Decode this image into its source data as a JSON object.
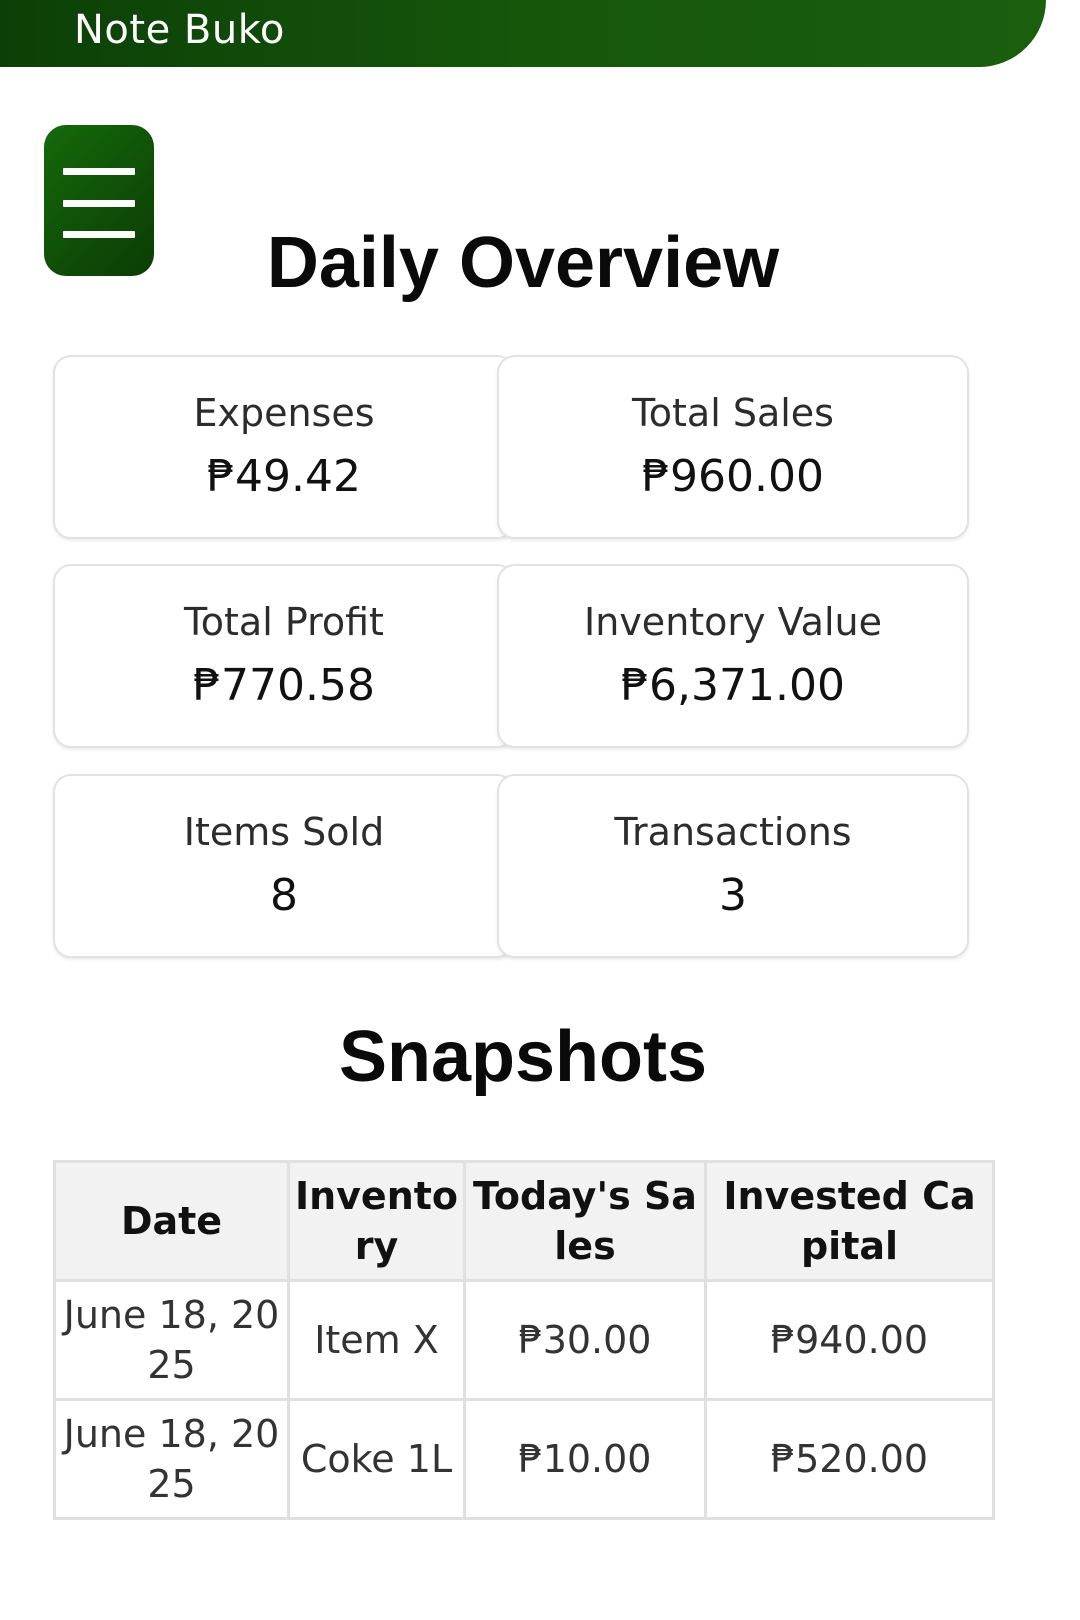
{
  "app": {
    "title": "Note Buko"
  },
  "menu": {
    "icon": "hamburger-menu-icon"
  },
  "overview": {
    "title": "Daily Overview",
    "cards": [
      {
        "label": "Expenses",
        "value": "₱49.42"
      },
      {
        "label": "Total Sales",
        "value": "₱960.00"
      },
      {
        "label": "Total Profit",
        "value": "₱770.58"
      },
      {
        "label": "Inventory Value",
        "value": "₱6,371.00"
      },
      {
        "label": "Items Sold",
        "value": "8"
      },
      {
        "label": "Transactions",
        "value": "3"
      }
    ]
  },
  "snapshots": {
    "title": "Snapshots",
    "headers": [
      "Date",
      "Inventory",
      "Today's Sales",
      "Invested Capital"
    ],
    "rows": [
      [
        "June 18, 2025",
        "Item X",
        "₱30.00",
        "₱940.00"
      ],
      [
        "June 18, 2025",
        "Coke 1L",
        "₱10.00",
        "₱520.00"
      ]
    ]
  },
  "colors": {
    "brand_green": "#15560b",
    "card_border": "#e2e2e2",
    "header_bg": "#f2f2f2"
  }
}
